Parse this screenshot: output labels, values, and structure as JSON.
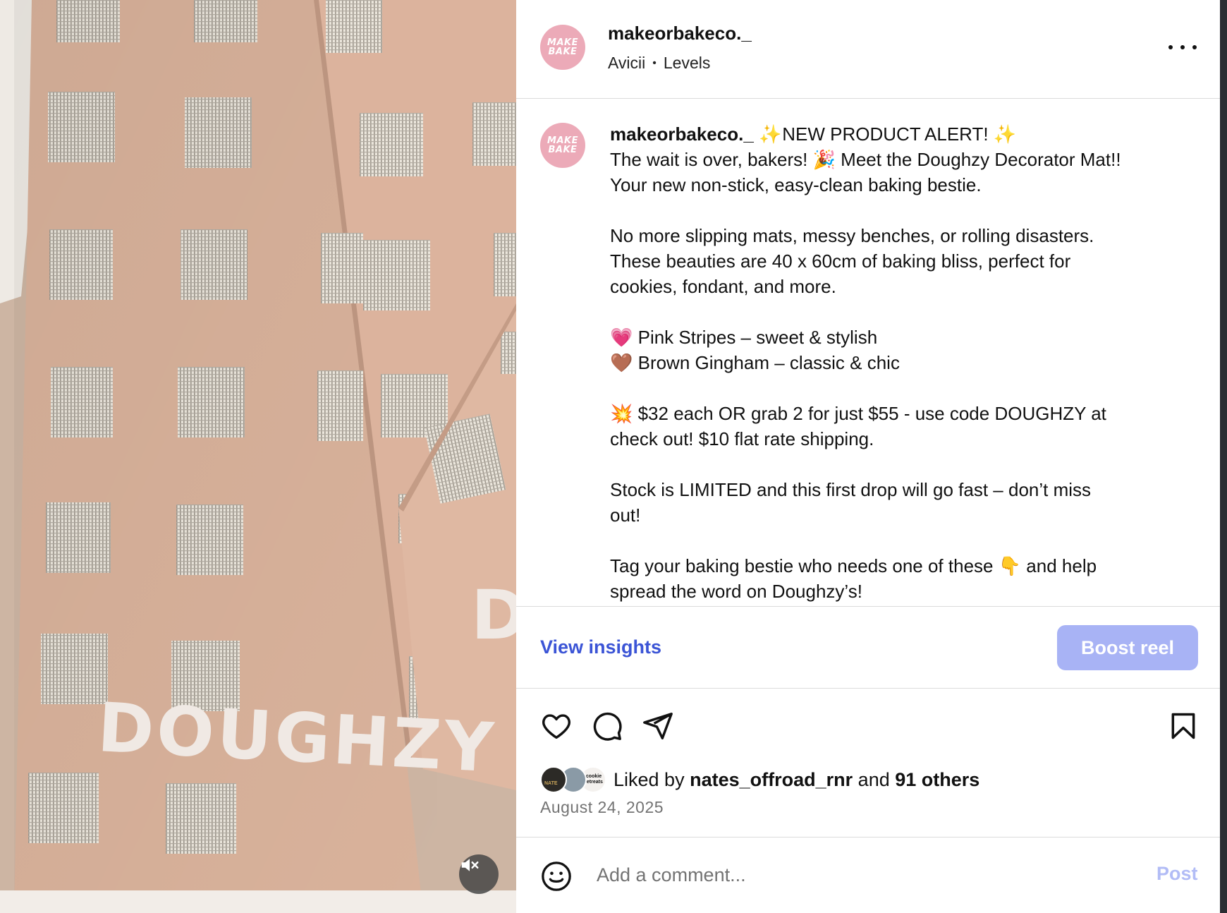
{
  "media": {
    "watermark_text": "DOUGHZY",
    "mute_icon": "speaker-muted-icon"
  },
  "header": {
    "username": "makeorbakeco._",
    "audio_artist": "Avicii",
    "audio_separator": "•",
    "audio_track": "Levels",
    "avatar_logo": [
      "MAKE",
      "BAKE"
    ],
    "more_icon": "more-horizontal-icon"
  },
  "caption": {
    "username": "makeorbakeco._",
    "lines": [
      {
        "emoji": "✨",
        "text": "NEW PRODUCT ALERT!",
        "emoji_after": "✨"
      },
      {
        "text": "The wait is over, bakers! 🎉 Meet the Doughzy Decorator Mat!!"
      },
      {
        "text": "Your new non-stick, easy-clean baking bestie."
      },
      {
        "text": ""
      },
      {
        "text": "No more slipping mats, messy benches, or rolling disasters."
      },
      {
        "text": "These beauties are 40 x 60cm of baking bliss, perfect for"
      },
      {
        "text": "cookies, fondant, and more."
      },
      {
        "text": ""
      },
      {
        "text": "💗 Pink Stripes – sweet & stylish"
      },
      {
        "text": "🤎 Brown Gingham – classic & chic"
      },
      {
        "text": ""
      },
      {
        "text": "💥 $32 each OR grab 2 for just $55 - use code DOUGHZY at"
      },
      {
        "text": "check out! $10 flat rate shipping."
      },
      {
        "text": ""
      },
      {
        "text": "Stock is LIMITED and this first drop will go fast – don’t miss"
      },
      {
        "text": "out!"
      },
      {
        "text": ""
      },
      {
        "text": "Tag your baking bestie who needs one of these 👇 and help"
      },
      {
        "text": "spread the word on Doughzy’s!"
      }
    ]
  },
  "insights": {
    "view_label": "View insights",
    "boost_label": "Boost reel"
  },
  "actions": {
    "like_icon": "heart-icon",
    "comment_icon": "comment-icon",
    "share_icon": "send-icon",
    "save_icon": "bookmark-icon"
  },
  "likes": {
    "prefix": "Liked by",
    "user": "nates_offroad_rnr",
    "middle": "and",
    "others": "91 others",
    "avatar_labels": [
      "NATE",
      "cookie retreats"
    ]
  },
  "date": "August 24, 2025",
  "comment": {
    "placeholder": "Add a comment...",
    "post_label": "Post",
    "emoji_icon": "smiley-icon"
  },
  "colors": {
    "link_blue": "#3b54d6",
    "boost_bg": "#a8b3f5",
    "post_disabled": "#b2bcf6",
    "avatar_pink": "#ecaab8"
  }
}
